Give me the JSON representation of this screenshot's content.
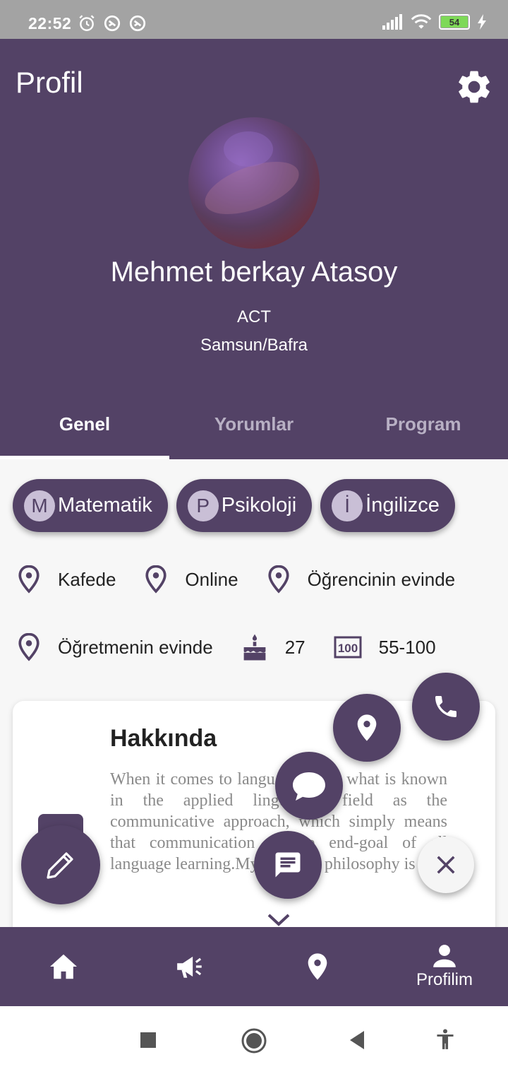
{
  "status_bar": {
    "time": "22:52",
    "battery": "54",
    "icons": [
      "alarm-icon",
      "sync-icon",
      "sync-icon",
      "signal-icon",
      "wifi-icon",
      "battery-icon",
      "charging-icon"
    ]
  },
  "header": {
    "title": "Profil",
    "settings_icon": "gear-icon",
    "name": "Mehmet berkay Atasoy",
    "line1": "ACT",
    "line2": "Samsun/Bafra"
  },
  "tabs": [
    {
      "label": "Genel",
      "active": true
    },
    {
      "label": "Yorumlar",
      "active": false
    },
    {
      "label": "Program",
      "active": false
    }
  ],
  "chips": [
    {
      "initial": "M",
      "label": "Matematik"
    },
    {
      "initial": "P",
      "label": "Psikoloji"
    },
    {
      "initial": "İ",
      "label": "İngilizce"
    }
  ],
  "info": {
    "row1": [
      {
        "icon": "location-pin-icon",
        "label": "Kafede"
      },
      {
        "icon": "location-pin-icon",
        "label": "Online"
      },
      {
        "icon": "location-pin-icon",
        "label": "Öğrencinin evinde"
      }
    ],
    "row2": [
      {
        "icon": "location-pin-icon",
        "label": "Öğretmenin evinde"
      },
      {
        "icon": "cake-icon",
        "label": "27"
      },
      {
        "icon": "price-icon",
        "label": "55-100"
      }
    ]
  },
  "about": {
    "title": "Hakkında",
    "text": "When it comes to language, I use what is known in the applied linguistics field as the communicative approach, which simply means that communication is the end-goal of all language learning.My teaching philosophy is to"
  },
  "fabs": [
    "phone-icon",
    "location-pin-icon",
    "chat-bubble-icon",
    "message-icon",
    "edit-icon",
    "close-icon"
  ],
  "bottom_nav": [
    {
      "icon": "home-icon",
      "label": ""
    },
    {
      "icon": "megaphone-icon",
      "label": ""
    },
    {
      "icon": "location-pin-icon",
      "label": ""
    },
    {
      "icon": "person-icon",
      "label": "Profilim"
    }
  ],
  "colors": {
    "primary": "#534266",
    "chip_initial_bg": "#c9bfd6",
    "status_bar": "#a3a3a3"
  }
}
